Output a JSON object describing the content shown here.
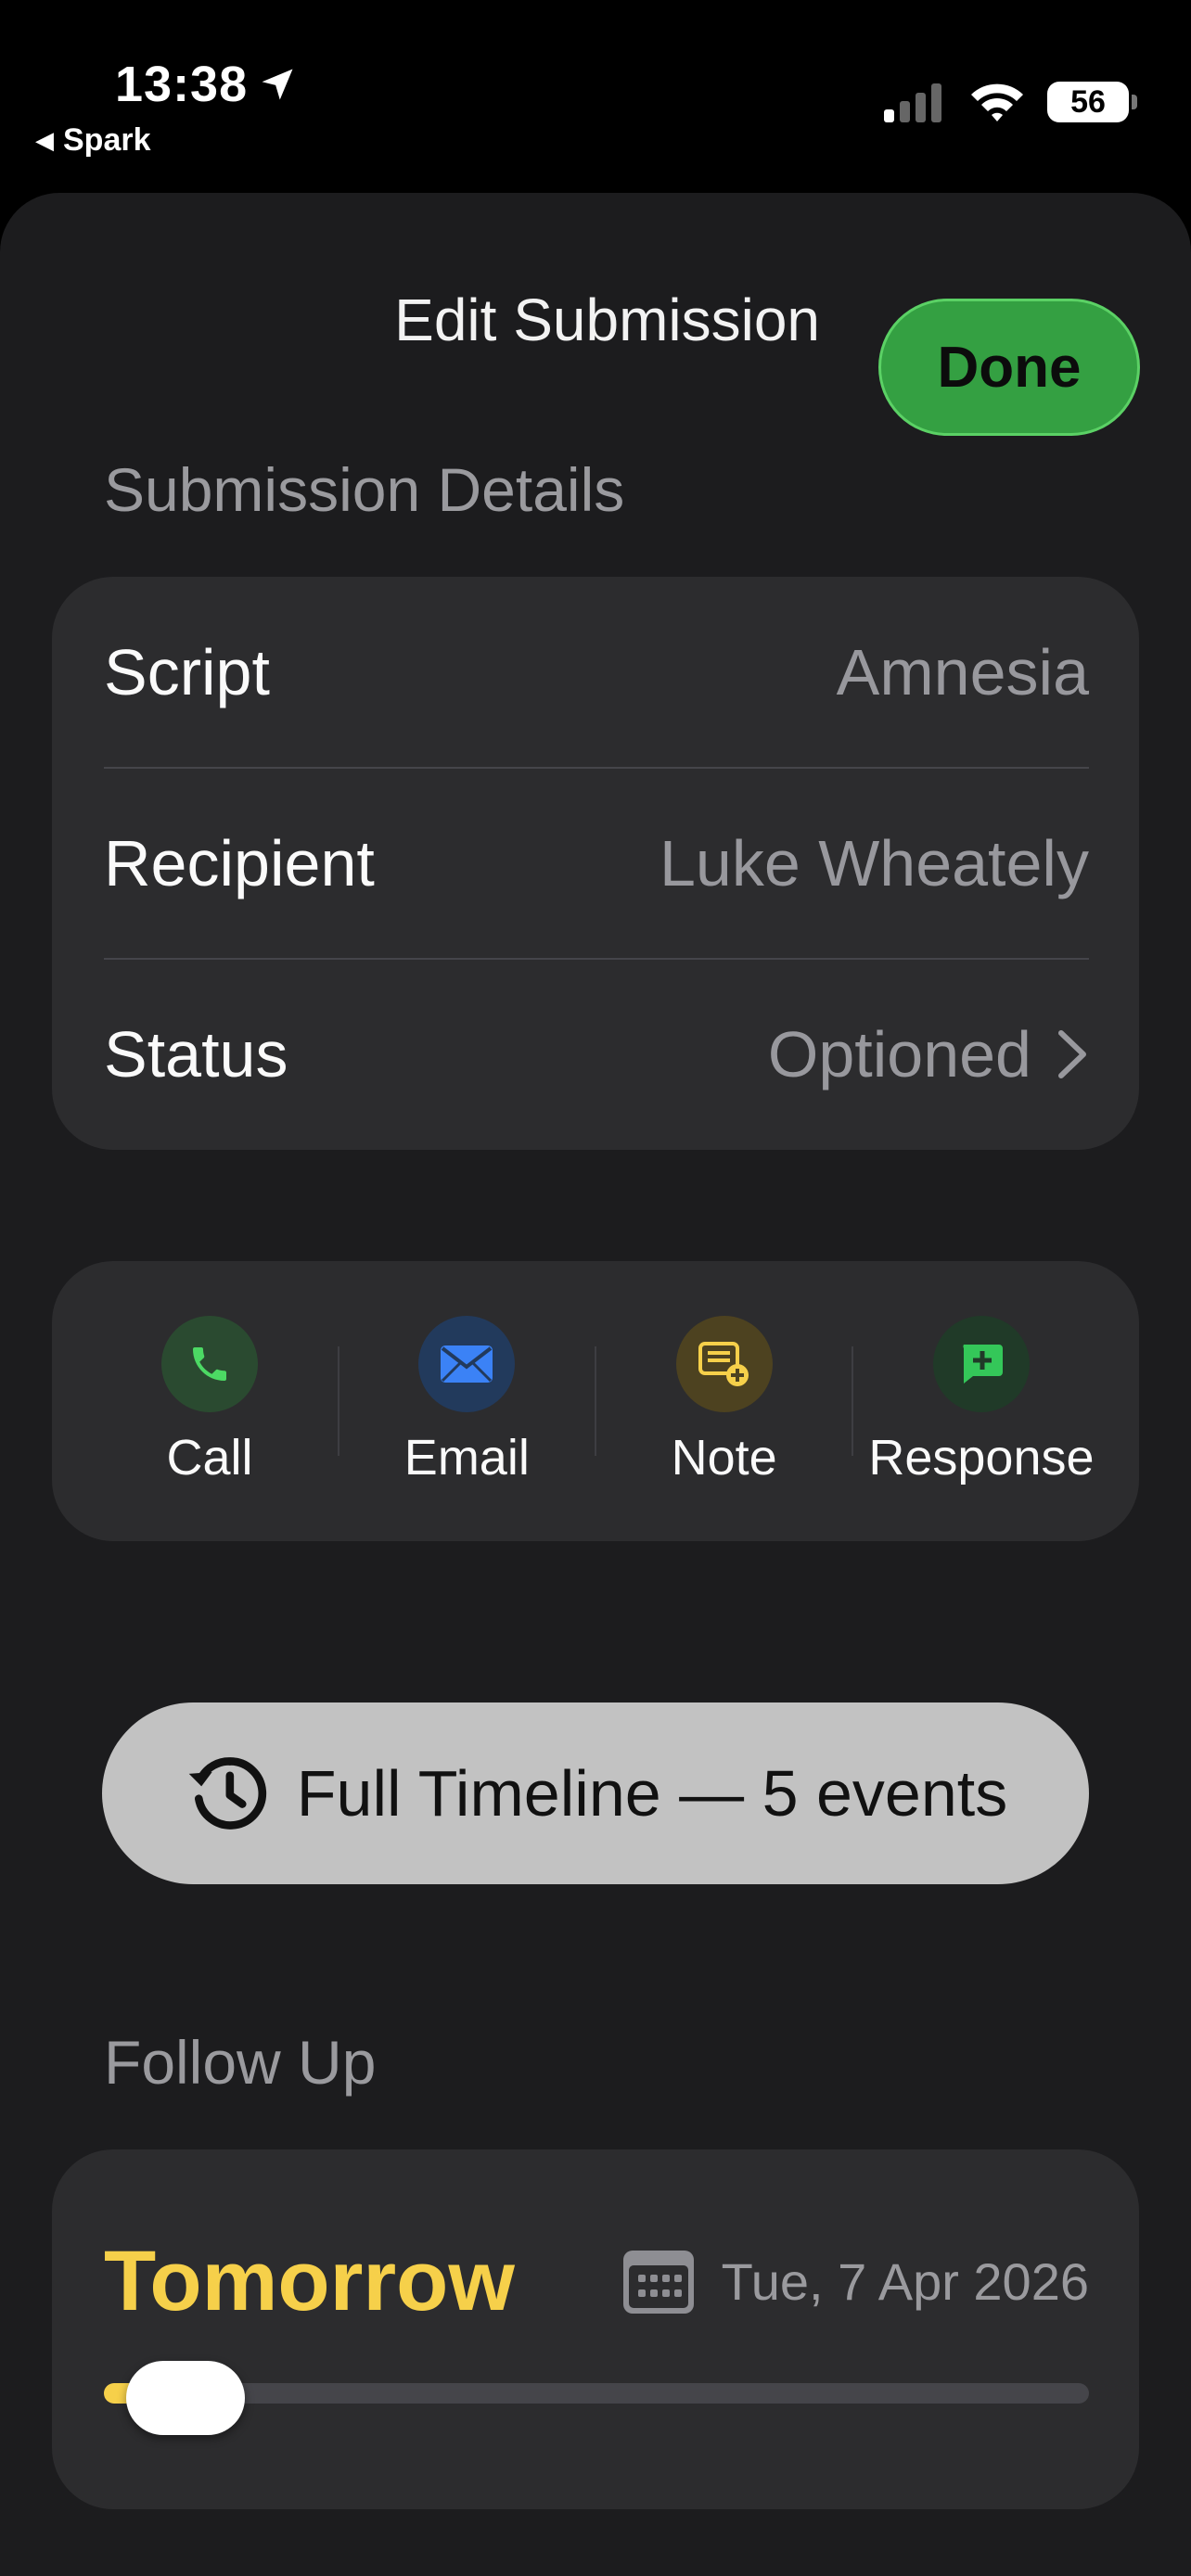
{
  "status_bar": {
    "time": "13:38",
    "back_app": "Spark",
    "battery": "56"
  },
  "sheet": {
    "title": "Edit Submission",
    "done_label": "Done"
  },
  "details": {
    "section_label": "Submission Details",
    "rows": [
      {
        "label": "Script",
        "value": "Amnesia"
      },
      {
        "label": "Recipient",
        "value": "Luke Wheately"
      },
      {
        "label": "Status",
        "value": "Optioned"
      }
    ]
  },
  "actions": [
    {
      "label": "Call",
      "icon": "phone-icon",
      "color": "#4cd964"
    },
    {
      "label": "Email",
      "icon": "envelope-icon",
      "color": "#3b82f6"
    },
    {
      "label": "Note",
      "icon": "note-add-icon",
      "color": "#f6d04a"
    },
    {
      "label": "Response",
      "icon": "message-add-icon",
      "color": "#34c759"
    }
  ],
  "timeline": {
    "label": "Full Timeline — 5 events"
  },
  "follow_up": {
    "section_label": "Follow Up",
    "relative": "Tomorrow",
    "date": "Tue, 7 Apr 2026",
    "slider_fraction": 0.05
  },
  "colors": {
    "accent_green": "#34a042",
    "accent_yellow": "#f6d04a",
    "card_bg": "#2c2c2e",
    "sheet_bg": "#1c1c1e"
  }
}
